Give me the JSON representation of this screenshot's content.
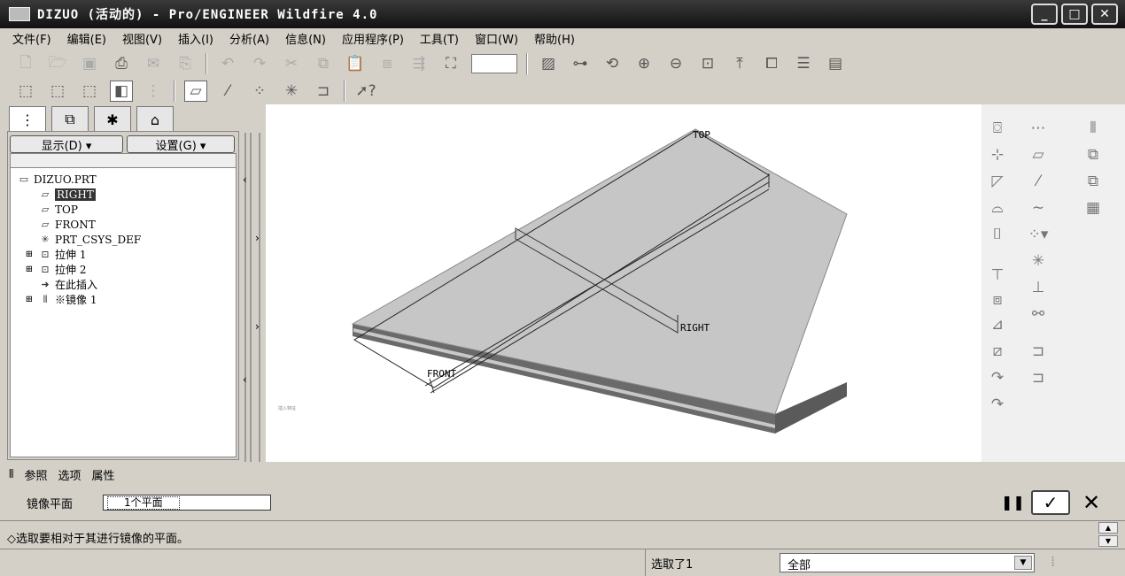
{
  "window": {
    "title": "DIZUO (活动的) - Pro/ENGINEER Wildfire 4.0",
    "minimize": "_",
    "maximize": "□",
    "close": "✕"
  },
  "menu": [
    "文件(F)",
    "编辑(E)",
    "视图(V)",
    "插入(I)",
    "分析(A)",
    "信息(N)",
    "应用程序(P)",
    "工具(T)",
    "窗口(W)",
    "帮助(H)"
  ],
  "navigator": {
    "show_button": "显示(D) ▾",
    "settings_button": "设置(G) ▾",
    "tree": [
      {
        "label": "DIZUO.PRT",
        "icon": "part-icon",
        "glyph": "▭",
        "expand": ""
      },
      {
        "label": "RIGHT",
        "icon": "datum-plane-icon",
        "glyph": "▱",
        "expand": "",
        "selected": true
      },
      {
        "label": "TOP",
        "icon": "datum-plane-icon",
        "glyph": "▱",
        "expand": ""
      },
      {
        "label": "FRONT",
        "icon": "datum-plane-icon",
        "glyph": "▱",
        "expand": ""
      },
      {
        "label": "PRT_CSYS_DEF",
        "icon": "csys-icon",
        "glyph": "✳",
        "expand": ""
      },
      {
        "label": "拉伸 1",
        "icon": "extrude-icon",
        "glyph": "⊡",
        "expand": "⊞"
      },
      {
        "label": "拉伸 2",
        "icon": "extrude-icon",
        "glyph": "⊡",
        "expand": "⊞"
      },
      {
        "label": "在此插入",
        "icon": "insert-here-arrow-icon",
        "glyph": "➜",
        "expand": ""
      },
      {
        "label": "※镜像 1",
        "icon": "mirror-icon",
        "glyph": "⫴",
        "expand": "⊞"
      }
    ]
  },
  "viewport": {
    "datum_labels": {
      "top": "TOP",
      "right": "RIGHT",
      "front": "FRONT"
    },
    "small_note": "插入特征"
  },
  "dashboard": {
    "tabs": [
      "参照",
      "选项",
      "属性"
    ],
    "mirror_plane_label": "镜像平面",
    "mirror_plane_value": "1个平面",
    "pause": "❚❚",
    "ok": "✓",
    "cancel": "✕"
  },
  "message": "◇选取要相对于其进行镜像的平面。",
  "status": {
    "selected": "选取了1",
    "filter": "全部"
  }
}
